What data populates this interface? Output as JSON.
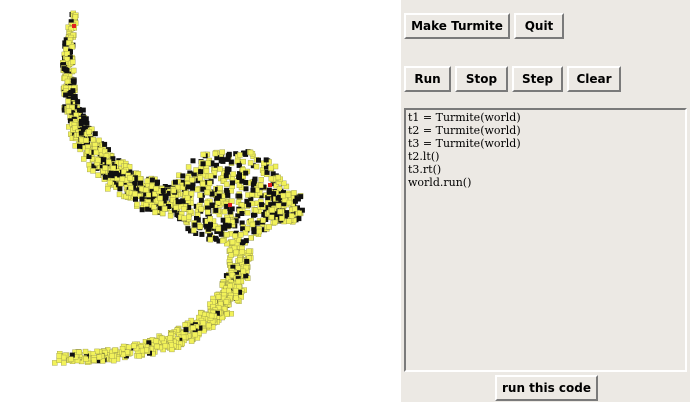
{
  "toolbar": {
    "make_turmite_label": "Make Turmite",
    "quit_label": "Quit"
  },
  "controls": {
    "run_label": "Run",
    "stop_label": "Stop",
    "step_label": "Step",
    "clear_label": "Clear"
  },
  "editor": {
    "lines": [
      "t1 = Turmite(world)",
      "t2 = Turmite(world)",
      "t3 = Turmite(world)",
      "t2.lt()",
      "t3.rt()",
      "world.run()"
    ]
  },
  "run_code_label": "run this code",
  "world": {
    "cell_color": "#f2f25a",
    "cell_border": "#9a9a4a",
    "ant_color": "#111111",
    "turmite_color": "#e02020",
    "turmite_count": 3
  }
}
